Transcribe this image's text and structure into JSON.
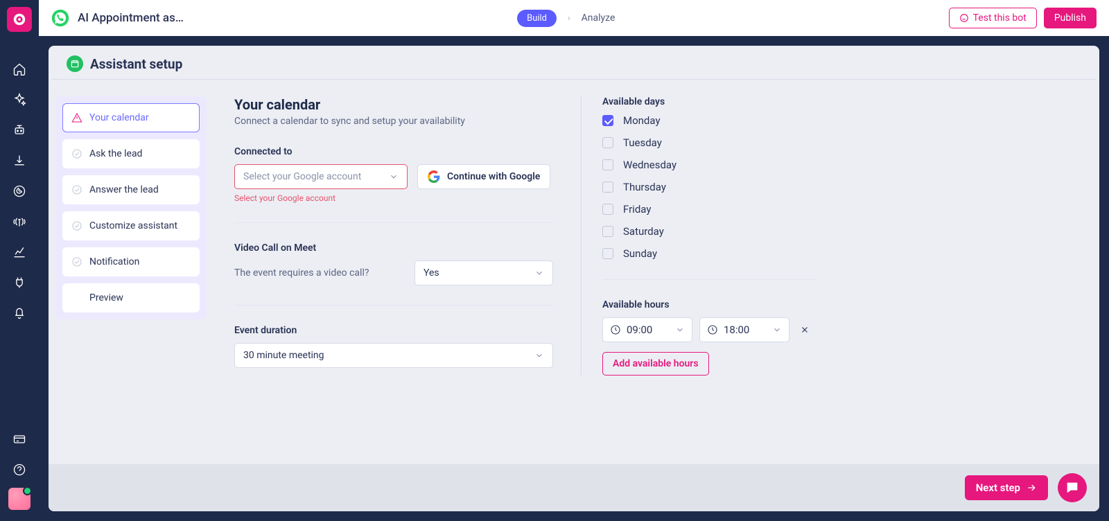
{
  "topbar": {
    "bot_title": "AI Appointment as…",
    "build_label": "Build",
    "analyze_label": "Analyze",
    "test_label": "Test this bot",
    "publish_label": "Publish"
  },
  "panel": {
    "title": "Assistant setup"
  },
  "steps": [
    {
      "label": "Your calendar",
      "status": "warn",
      "active": true
    },
    {
      "label": "Ask the lead",
      "status": "pending"
    },
    {
      "label": "Answer the lead",
      "status": "pending"
    },
    {
      "label": "Customize assistant",
      "status": "pending"
    },
    {
      "label": "Notification",
      "status": "pending"
    },
    {
      "label": "Preview",
      "status": "plain"
    }
  ],
  "form": {
    "heading": "Your calendar",
    "subheading": "Connect a calendar to sync and setup your availability",
    "connected_label": "Connected to",
    "account_placeholder": "Select your Google account",
    "account_error": "Select your Google account",
    "google_btn": "Continue with Google",
    "video_label": "Video Call on Meet",
    "video_question": "The event requires a video call?",
    "video_value": "Yes",
    "duration_label": "Event duration",
    "duration_value": "30 minute meeting"
  },
  "availability": {
    "days_label": "Available days",
    "days": [
      {
        "name": "Monday",
        "checked": true
      },
      {
        "name": "Tuesday",
        "checked": false
      },
      {
        "name": "Wednesday",
        "checked": false
      },
      {
        "name": "Thursday",
        "checked": false
      },
      {
        "name": "Friday",
        "checked": false
      },
      {
        "name": "Saturday",
        "checked": false
      },
      {
        "name": "Sunday",
        "checked": false
      }
    ],
    "hours_label": "Available hours",
    "from": "09:00",
    "to": "18:00",
    "add_label": "Add available hours"
  },
  "footer": {
    "next_label": "Next step"
  }
}
